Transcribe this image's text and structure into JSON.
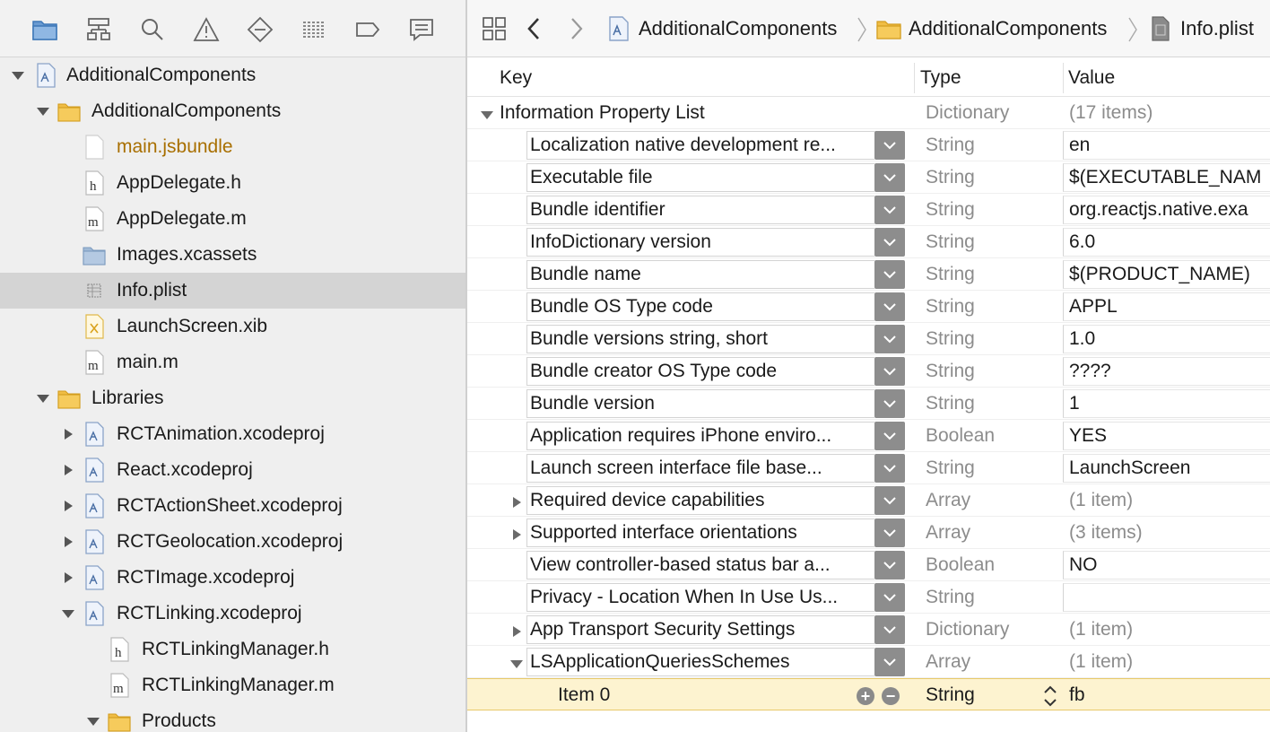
{
  "navigator": {
    "toolbar_icons": [
      "folder-icon",
      "hierarchy-icon",
      "search-icon",
      "warning-icon",
      "test-icon",
      "debug-icon",
      "breakpoint-icon",
      "report-icon"
    ],
    "tree": [
      {
        "label": "AdditionalComponents",
        "icon": "project-icon",
        "expanded": true
      },
      {
        "label": "AdditionalComponents",
        "icon": "folder-icon",
        "expanded": true
      },
      {
        "label": "main.jsbundle",
        "icon": "file-icon"
      },
      {
        "label": "AppDelegate.h",
        "icon": "header-file-icon"
      },
      {
        "label": "AppDelegate.m",
        "icon": "source-file-icon"
      },
      {
        "label": "Images.xcassets",
        "icon": "asset-folder-icon"
      },
      {
        "label": "Info.plist",
        "icon": "plist-file-icon",
        "selected": true
      },
      {
        "label": "LaunchScreen.xib",
        "icon": "xib-file-icon"
      },
      {
        "label": "main.m",
        "icon": "source-file-icon"
      },
      {
        "label": "Libraries",
        "icon": "folder-icon",
        "expanded": true
      },
      {
        "label": "RCTAnimation.xcodeproj",
        "icon": "project-icon",
        "expanded": false
      },
      {
        "label": "React.xcodeproj",
        "icon": "project-icon",
        "expanded": false
      },
      {
        "label": "RCTActionSheet.xcodeproj",
        "icon": "project-icon",
        "expanded": false
      },
      {
        "label": "RCTGeolocation.xcodeproj",
        "icon": "project-icon",
        "expanded": false
      },
      {
        "label": "RCTImage.xcodeproj",
        "icon": "project-icon",
        "expanded": false
      },
      {
        "label": "RCTLinking.xcodeproj",
        "icon": "project-icon",
        "expanded": true
      },
      {
        "label": "RCTLinkingManager.h",
        "icon": "header-file-icon"
      },
      {
        "label": "RCTLinkingManager.m",
        "icon": "source-file-icon"
      },
      {
        "label": "Products",
        "icon": "folder-icon",
        "expanded": true
      }
    ]
  },
  "jumpbar": {
    "crumbs": [
      "AdditionalComponents",
      "AdditionalComponents",
      "Info.plist"
    ]
  },
  "plist": {
    "headers": {
      "key": "Key",
      "type": "Type",
      "value": "Value"
    },
    "root": {
      "key": "Information Property List",
      "type": "Dictionary",
      "value": "(17 items)"
    },
    "rows": [
      {
        "key": "Localization native development re...",
        "type": "String",
        "value": "en"
      },
      {
        "key": "Executable file",
        "type": "String",
        "value": "$(EXECUTABLE_NAM"
      },
      {
        "key": "Bundle identifier",
        "type": "String",
        "value": "org.reactjs.native.exa"
      },
      {
        "key": "InfoDictionary version",
        "type": "String",
        "value": "6.0"
      },
      {
        "key": "Bundle name",
        "type": "String",
        "value": "$(PRODUCT_NAME)"
      },
      {
        "key": "Bundle OS Type code",
        "type": "String",
        "value": "APPL"
      },
      {
        "key": "Bundle versions string, short",
        "type": "String",
        "value": "1.0"
      },
      {
        "key": "Bundle creator OS Type code",
        "type": "String",
        "value": "????"
      },
      {
        "key": "Bundle version",
        "type": "String",
        "value": "1"
      },
      {
        "key": "Application requires iPhone enviro...",
        "type": "Boolean",
        "value": "YES"
      },
      {
        "key": "Launch screen interface file base...",
        "type": "String",
        "value": "LaunchScreen"
      },
      {
        "key": "Required device capabilities",
        "type": "Array",
        "value": "(1 item)",
        "collapsible": "collapsed"
      },
      {
        "key": "Supported interface orientations",
        "type": "Array",
        "value": "(3 items)",
        "collapsible": "collapsed"
      },
      {
        "key": "View controller-based status bar a...",
        "type": "Boolean",
        "value": "NO"
      },
      {
        "key": "Privacy - Location When In Use Us...",
        "type": "String",
        "value": ""
      },
      {
        "key": "App Transport Security Settings",
        "type": "Dictionary",
        "value": "(1 item)",
        "collapsible": "collapsed"
      },
      {
        "key": "LSApplicationQueriesSchemes",
        "type": "Array",
        "value": "(1 item)",
        "collapsible": "expanded"
      }
    ],
    "editing_row": {
      "key": "Item 0",
      "type": "String",
      "value": "fb"
    }
  }
}
